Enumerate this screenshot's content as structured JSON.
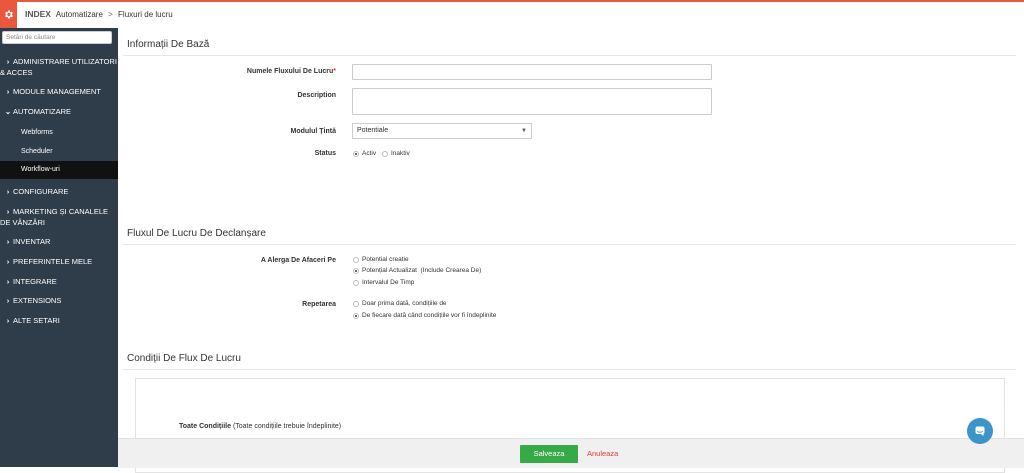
{
  "breadcrumb": {
    "app": "INDEX",
    "items": [
      "Automatizare",
      "Fluxuri de lucru"
    ]
  },
  "sidebar": {
    "search_placeholder": "Setări de căutare",
    "items": [
      {
        "label": "ADMINISTRARE UTILIZATORI & ACCES",
        "expanded": false
      },
      {
        "label": "MODULE MANAGEMENT",
        "expanded": false
      },
      {
        "label": "AUTOMATIZARE",
        "expanded": true
      },
      {
        "label": "CONFIGURARE",
        "expanded": false
      },
      {
        "label": "MARKETING ȘI CANALELE DE VÂNZĂRI",
        "expanded": false
      },
      {
        "label": "INVENTAR",
        "expanded": false
      },
      {
        "label": "PREFERINTELE MELE",
        "expanded": false
      },
      {
        "label": "INTEGRARE",
        "expanded": false
      },
      {
        "label": "EXTENSIONS",
        "expanded": false
      },
      {
        "label": "ALTE SETARI",
        "expanded": false
      }
    ],
    "subitems": [
      {
        "label": "Webforms",
        "active": false
      },
      {
        "label": "Scheduler",
        "active": false
      },
      {
        "label": "Workflow-uri",
        "active": true
      }
    ]
  },
  "basic_info": {
    "title": "Informații De Bază",
    "name_label": "Numele Fluxului De Lucru",
    "name_required": "*",
    "name_value": "",
    "description_label": "Description",
    "description_value": "",
    "module_label": "Modulul Țintă",
    "module_value": "Potentiale",
    "status_label": "Status",
    "status_options": [
      "Activ",
      "Inaktiv"
    ],
    "status_selected": "Activ"
  },
  "trigger": {
    "title": "Fluxul De Lucru De Declanșare",
    "run_label": "A Alerga De Afaceri Pe",
    "run_options": [
      "Potential creatie",
      "Potențial Actualizat  (Include Crearea De)",
      "Intervalul De Timp"
    ],
    "run_selected": 1,
    "repeat_label": "Repetarea",
    "repeat_options": [
      "Doar prima dată, condițiile de",
      "De fiecare dată când condițiile vor fi îndeplinite"
    ],
    "repeat_selected": 1
  },
  "conditions": {
    "title": "Condiții De Flux De Lucru",
    "all_label": "Toate Condițiile",
    "all_hint": "(Toate condițiile trebuie îndeplinite)"
  },
  "footer": {
    "save_label": "Salveaza",
    "cancel_label": "Anuleaza"
  },
  "colors": {
    "accent": "#e9573f",
    "sidebar_bg": "#2f3d4a",
    "save_button": "#35aa47",
    "cancel_link": "#e53935",
    "chat_button": "#3d94c8"
  },
  "icons": {
    "logo": "gear-icon",
    "chat": "chat-icon"
  }
}
